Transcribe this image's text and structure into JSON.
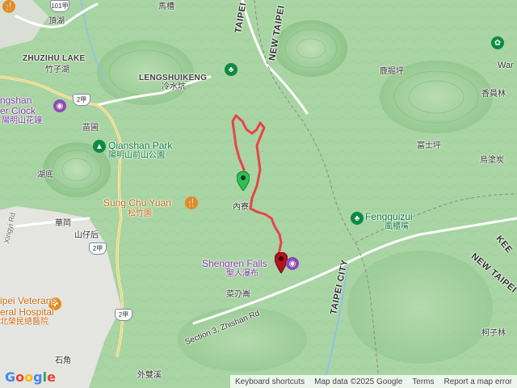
{
  "map": {
    "labels": {
      "top_pinyin": "頂湖",
      "zhuzihu_lake": "ZHUZIHU LAKE",
      "zhuzihu_cn": "竹子湖",
      "clock_en_1": "ngshan",
      "clock_en_2": "er Clock",
      "clock_cn": "陽明山花鐘",
      "miaopu": "苗圃",
      "qianshan_park": "Qianshan Park",
      "qianshan_cn": "陽明山前山公園",
      "hudi": "湖底",
      "sung_chu_yuan": "Sung Chu Yuan",
      "sung_chu_cn": "松竹園",
      "huagang": "華岡",
      "shanzaihou": "山仔后",
      "xingyi": "Xingyi Rd",
      "veterans_1": "ipei Veterans",
      "veterans_2": "eral Hospital",
      "veterans_cn": "北榮民總醫院",
      "shijiao": "石角",
      "waishuangxi": "外雙溪",
      "lengshuikeng": "LENGSHUIKENG",
      "lengshuikeng_cn": "冷水坑",
      "maocao": "馬槽",
      "neiliao": "內寮",
      "shengren_falls": "Shengren Falls",
      "shengren_cn": "聖人瀑布",
      "yeqieliao": "菜刅崙",
      "zhishan_rd": "Section 3, Zhishan Rd",
      "lujueping": "鹿掘坪",
      "xiangyuanlin": "香員林",
      "fushiping": "富士坪",
      "wututan": "烏塗炭",
      "fengguizui": "Fengguizui",
      "fengguizui_cn": "風櫃嘴",
      "kezilin": "柯子林",
      "war": "War",
      "taipei_city_top": "TAIPEI",
      "new_taipei_top": "NEW TAIPEI",
      "taipei_city_right": "TAIPEI CITY",
      "new_taipei_right": "NEW TAIPEI CITY",
      "new_taipei_far": "NEW TAIPEI",
      "kee": "KEE"
    },
    "road_shields": {
      "r2_a": "2甲",
      "r2_b": "2甲",
      "r2_c": "2甲",
      "r101": "101甲"
    },
    "poi_icons": {
      "lengshuikeng": "hiking-icon",
      "qianshan": "tree-icon",
      "clock": "camera-icon",
      "sung_chu": "restaurant-icon",
      "veterans": "hospital-icon",
      "shengren": "camera-icon",
      "fengguizui": "hiking-icon",
      "top_right": "flower-icon"
    },
    "colors": {
      "track": "#e8434a",
      "start_marker": "#2fbf52",
      "end_marker": "#b3131e",
      "forest": "#9fcf9a",
      "urban": "#e6e6e6"
    }
  },
  "footer": {
    "logo": "Google",
    "keyboard": "Keyboard shortcuts",
    "map_data": "Map data ©2025 Google",
    "terms": "Terms",
    "report": "Report a map error"
  }
}
